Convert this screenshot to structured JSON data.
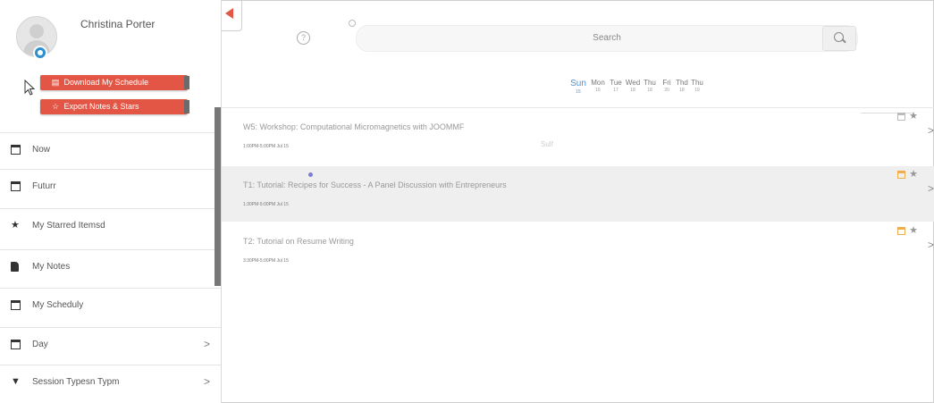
{
  "profile": {
    "name": "Christina Porter"
  },
  "actions": {
    "download_label": "Download My Schedule",
    "export_label": "Export Notes & Stars"
  },
  "menu": {
    "items": [
      {
        "label": "Now",
        "icon": "calendar-icon"
      },
      {
        "label": "Futurr",
        "icon": "calendar-icon"
      },
      {
        "label": "My Starred Itemsd",
        "icon": "star-icon"
      },
      {
        "label": "My Notes",
        "icon": "note-icon"
      },
      {
        "label": "My Scheduly",
        "icon": "calendar-icon"
      },
      {
        "label": "Day",
        "icon": "calendar-icon",
        "chevron": ">"
      },
      {
        "label": "Session Typesn Typm",
        "icon": "filter-icon",
        "chevron": ">"
      }
    ]
  },
  "search": {
    "placeholder": "Search"
  },
  "days": [
    {
      "name": "Sun",
      "date": "15",
      "active": true
    },
    {
      "name": "Mon",
      "date": "16"
    },
    {
      "name": "Tue",
      "date": "17"
    },
    {
      "name": "Wed",
      "date": "18"
    },
    {
      "name": "Thu",
      "date": "18"
    },
    {
      "name": "Fri",
      "date": "20"
    },
    {
      "name": "Thd",
      "date": "18"
    },
    {
      "name": "Thu",
      "date": "19"
    }
  ],
  "sessions": [
    {
      "title": "W5: Workshop: Computational Micromagnetics with JOOMMF",
      "time": "1:00PM-5:00PM Jul 15",
      "chip": "Sulf",
      "starred": false,
      "in_schedule": false,
      "highlighted": false
    },
    {
      "title": "T1: Tutorial: Recipes for Success - A Panel Discussion with Entrepreneurs",
      "time": "1:30PM-5:00PM Jul 15",
      "starred": false,
      "in_schedule": true,
      "highlighted": true
    },
    {
      "title": "T2: Tutorial on Resume Writing",
      "time": "3:30PM-5:00PM Jul 15",
      "starred": false,
      "in_schedule": true,
      "highlighted": false
    }
  ],
  "colors": {
    "accent_red": "#e35545",
    "active_day_blue": "#4a90d9",
    "schedule_orange": "#f0ad4e",
    "badge_blue": "#2c8fd1"
  }
}
